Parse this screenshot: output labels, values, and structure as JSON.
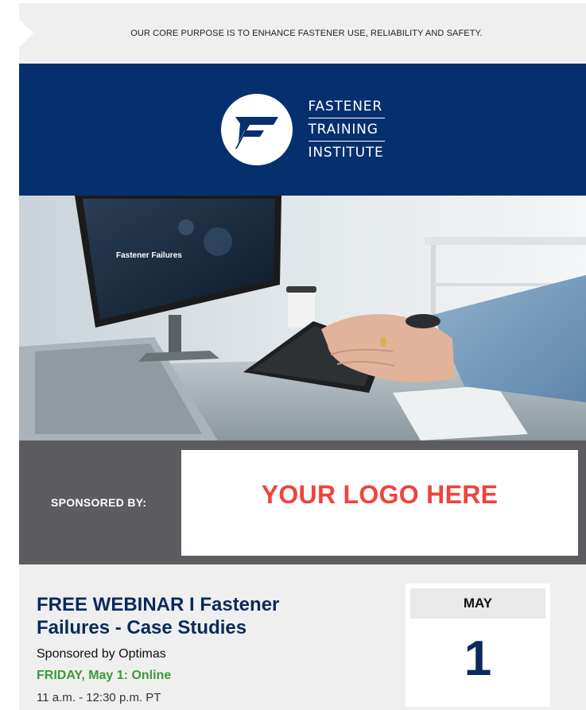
{
  "tagline": "OUR CORE PURPOSE IS TO ENHANCE FASTENER USE, RELIABILITY AND SAFETY.",
  "brand": {
    "words": [
      "FASTENER",
      "TRAINING",
      "INSTITUTE"
    ],
    "color": "#062f6e"
  },
  "hero": {
    "screen_text": "Fastener Failures"
  },
  "sponsor": {
    "label": "SPONSORED BY:",
    "logo_placeholder": "YOUR LOGO HERE",
    "logo_color": "#f0433c"
  },
  "webinar": {
    "title": "FREE WEBINAR I Fastener Failures - Case Studies",
    "sponsored_by": "Sponsored by Optimas",
    "date_line": "FRIDAY, May 1: Online",
    "time_line": "11 a.m. - 12:30 p.m. PT",
    "calendar": {
      "month": "MAY",
      "day": "1"
    },
    "date_color": "#3b9a3b"
  }
}
